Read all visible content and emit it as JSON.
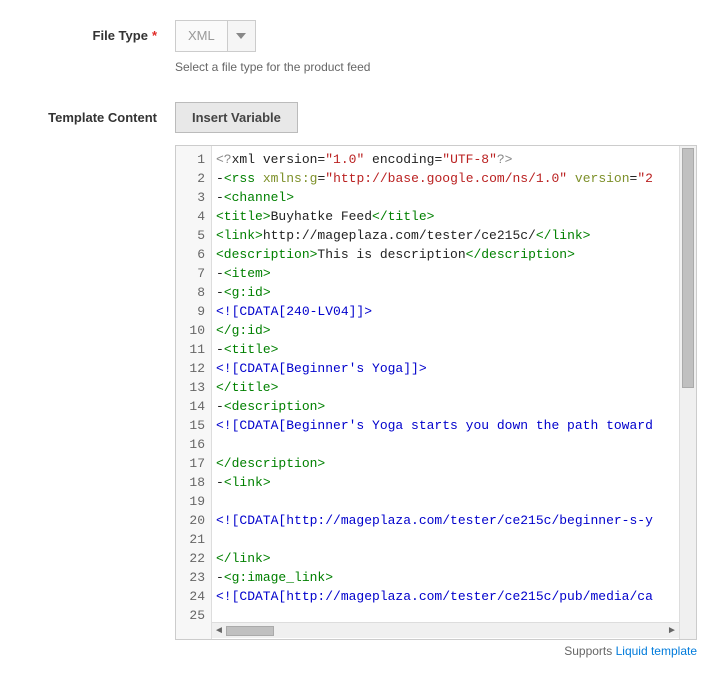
{
  "fileType": {
    "label": "File Type",
    "required": true,
    "value": "XML",
    "hint": "Select a file type for the product feed"
  },
  "templateContent": {
    "label": "Template Content",
    "insertButton": "Insert Variable",
    "footerPrefix": "Supports ",
    "footerLink": "Liquid template",
    "code": [
      [
        {
          "c": "t-punct",
          "t": "<?"
        },
        {
          "c": "",
          "t": "xml version="
        },
        {
          "c": "t-str",
          "t": "\"1.0\""
        },
        {
          "c": "",
          "t": " encoding="
        },
        {
          "c": "t-str",
          "t": "\"UTF-8\""
        },
        {
          "c": "t-punct",
          "t": "?>"
        }
      ],
      [
        {
          "c": "",
          "t": "-"
        },
        {
          "c": "t-tag",
          "t": "<rss"
        },
        {
          "c": "",
          "t": " "
        },
        {
          "c": "t-attr",
          "t": "xmlns:g"
        },
        {
          "c": "",
          "t": "="
        },
        {
          "c": "t-str",
          "t": "\"http://base.google.com/ns/1.0\""
        },
        {
          "c": "",
          "t": " "
        },
        {
          "c": "t-attr",
          "t": "version"
        },
        {
          "c": "",
          "t": "="
        },
        {
          "c": "t-str",
          "t": "\"2"
        }
      ],
      [
        {
          "c": "",
          "t": "-"
        },
        {
          "c": "t-tag",
          "t": "<channel>"
        }
      ],
      [
        {
          "c": "t-tag",
          "t": "<title>"
        },
        {
          "c": "",
          "t": "Buyhatke Feed"
        },
        {
          "c": "t-tag",
          "t": "</title>"
        }
      ],
      [
        {
          "c": "t-tag",
          "t": "<link>"
        },
        {
          "c": "",
          "t": "http://mageplaza.com/tester/ce215c/"
        },
        {
          "c": "t-tag",
          "t": "</link>"
        }
      ],
      [
        {
          "c": "t-tag",
          "t": "<description>"
        },
        {
          "c": "",
          "t": "This is description"
        },
        {
          "c": "t-tag",
          "t": "</description>"
        }
      ],
      [
        {
          "c": "",
          "t": "-"
        },
        {
          "c": "t-tag",
          "t": "<item>"
        }
      ],
      [
        {
          "c": "",
          "t": "-"
        },
        {
          "c": "t-tag",
          "t": "<g:id>"
        }
      ],
      [
        {
          "c": "t-cdata",
          "t": "<![CDATA[240-LV04]]>"
        }
      ],
      [
        {
          "c": "t-tag",
          "t": "</g:id>"
        }
      ],
      [
        {
          "c": "",
          "t": "-"
        },
        {
          "c": "t-tag",
          "t": "<title>"
        }
      ],
      [
        {
          "c": "t-cdata",
          "t": "<![CDATA[Beginner's Yoga]]>"
        }
      ],
      [
        {
          "c": "t-tag",
          "t": "</title>"
        }
      ],
      [
        {
          "c": "",
          "t": "-"
        },
        {
          "c": "t-tag",
          "t": "<description>"
        }
      ],
      [
        {
          "c": "t-cdata",
          "t": "<![CDATA[Beginner's Yoga starts you down the path toward"
        }
      ],
      [
        {
          "c": "",
          "t": ""
        }
      ],
      [
        {
          "c": "t-tag",
          "t": "</description>"
        }
      ],
      [
        {
          "c": "",
          "t": "-"
        },
        {
          "c": "t-tag",
          "t": "<link>"
        }
      ],
      [
        {
          "c": "",
          "t": ""
        }
      ],
      [
        {
          "c": "t-cdata",
          "t": "<![CDATA[http://mageplaza.com/tester/ce215c/beginner-s-y"
        }
      ],
      [
        {
          "c": "",
          "t": ""
        }
      ],
      [
        {
          "c": "t-tag",
          "t": "</link>"
        }
      ],
      [
        {
          "c": "",
          "t": "-"
        },
        {
          "c": "t-tag",
          "t": "<g:image_link>"
        }
      ],
      [
        {
          "c": "t-cdata",
          "t": "<![CDATA[http://mageplaza.com/tester/ce215c/pub/media/ca"
        }
      ],
      [
        {
          "c": "",
          "t": ""
        }
      ]
    ]
  }
}
